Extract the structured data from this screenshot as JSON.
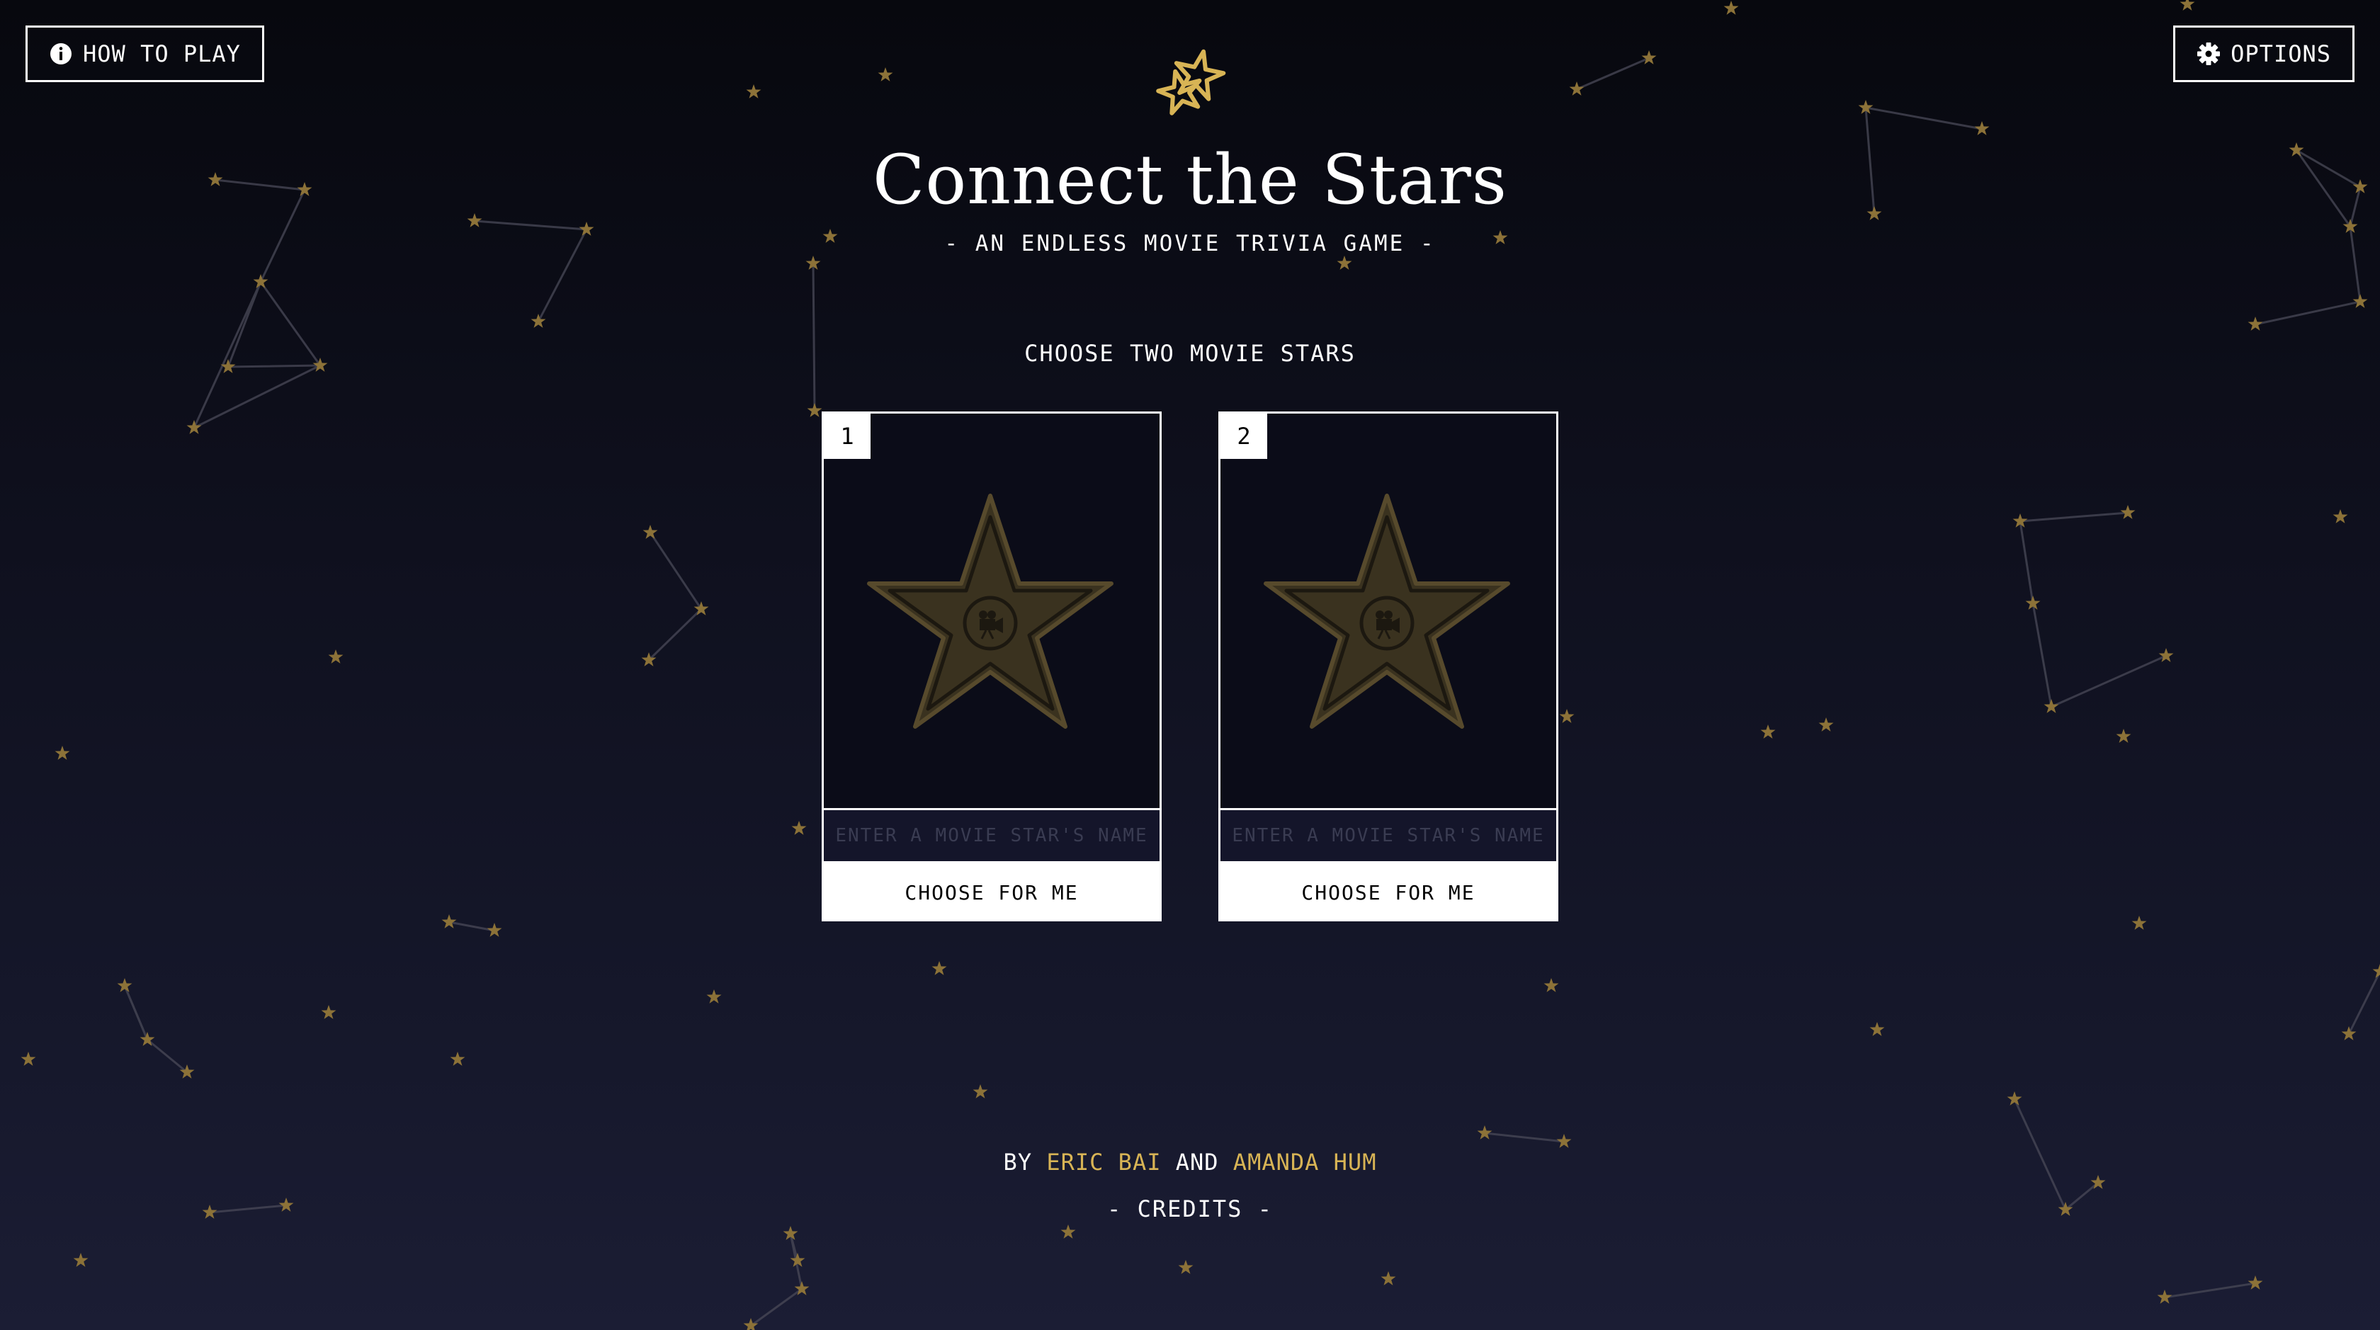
{
  "header": {
    "how_to_play_label": "HOW TO PLAY",
    "options_label": "OPTIONS",
    "how_to_play_icon": "info-icon",
    "options_icon": "gear-icon",
    "logo_icon": "twin-stars-logo-icon",
    "title": "Connect the Stars",
    "subtitle": "- AN ENDLESS MOVIE TRIVIA GAME -"
  },
  "main": {
    "heading": "CHOOSE TWO MOVIE STARS",
    "cards": [
      {
        "number": "1",
        "placeholder": "ENTER A MOVIE STAR'S NAME",
        "value": "",
        "choose_label": "CHOOSE FOR ME",
        "image_icon": "walk-of-fame-star-placeholder-icon"
      },
      {
        "number": "2",
        "placeholder": "ENTER A MOVIE STAR'S NAME",
        "value": "",
        "choose_label": "CHOOSE FOR ME",
        "image_icon": "walk-of-fame-star-placeholder-icon"
      }
    ]
  },
  "footer": {
    "by": "BY",
    "author1": "ERIC BAI",
    "and": "AND",
    "author2": "AMANDA HUM",
    "credits_label": "- CREDITS -"
  },
  "colors": {
    "accent_gold": "#d8b455",
    "star_gold": "#8c7238",
    "background_top": "#07080e",
    "background_bottom": "#1b1d34",
    "text": "#ffffff"
  }
}
